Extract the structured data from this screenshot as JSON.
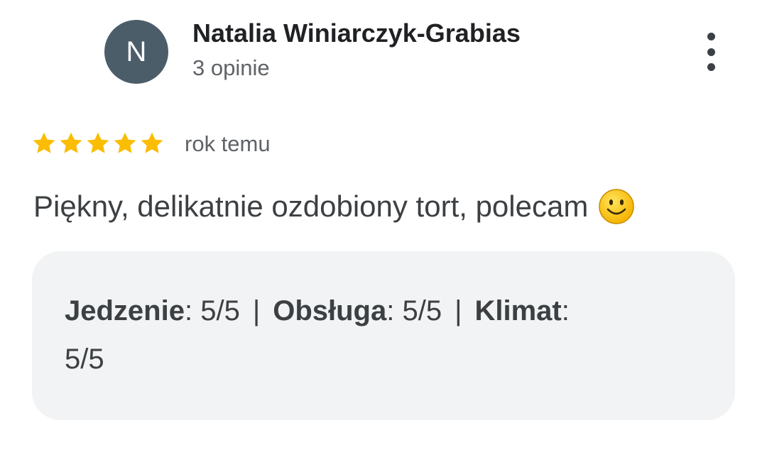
{
  "review": {
    "author": {
      "initial": "N",
      "name": "Natalia Winiarczyk-Grabias",
      "review_count": "3 opinie",
      "avatar_color": "#4c5d6a"
    },
    "rating_stars": 5,
    "star_color": "#fbbc04",
    "time_ago": "rok temu",
    "text": "Piękny, delikatnie ozdobiony tort, polecam",
    "emoji_icon": "smiley-icon",
    "aspect_ratings": [
      {
        "label": "Jedzenie",
        "value": "5/5"
      },
      {
        "label": "Obsługa",
        "value": "5/5"
      },
      {
        "label": "Klimat",
        "value": "5/5"
      }
    ],
    "separator": "|"
  }
}
